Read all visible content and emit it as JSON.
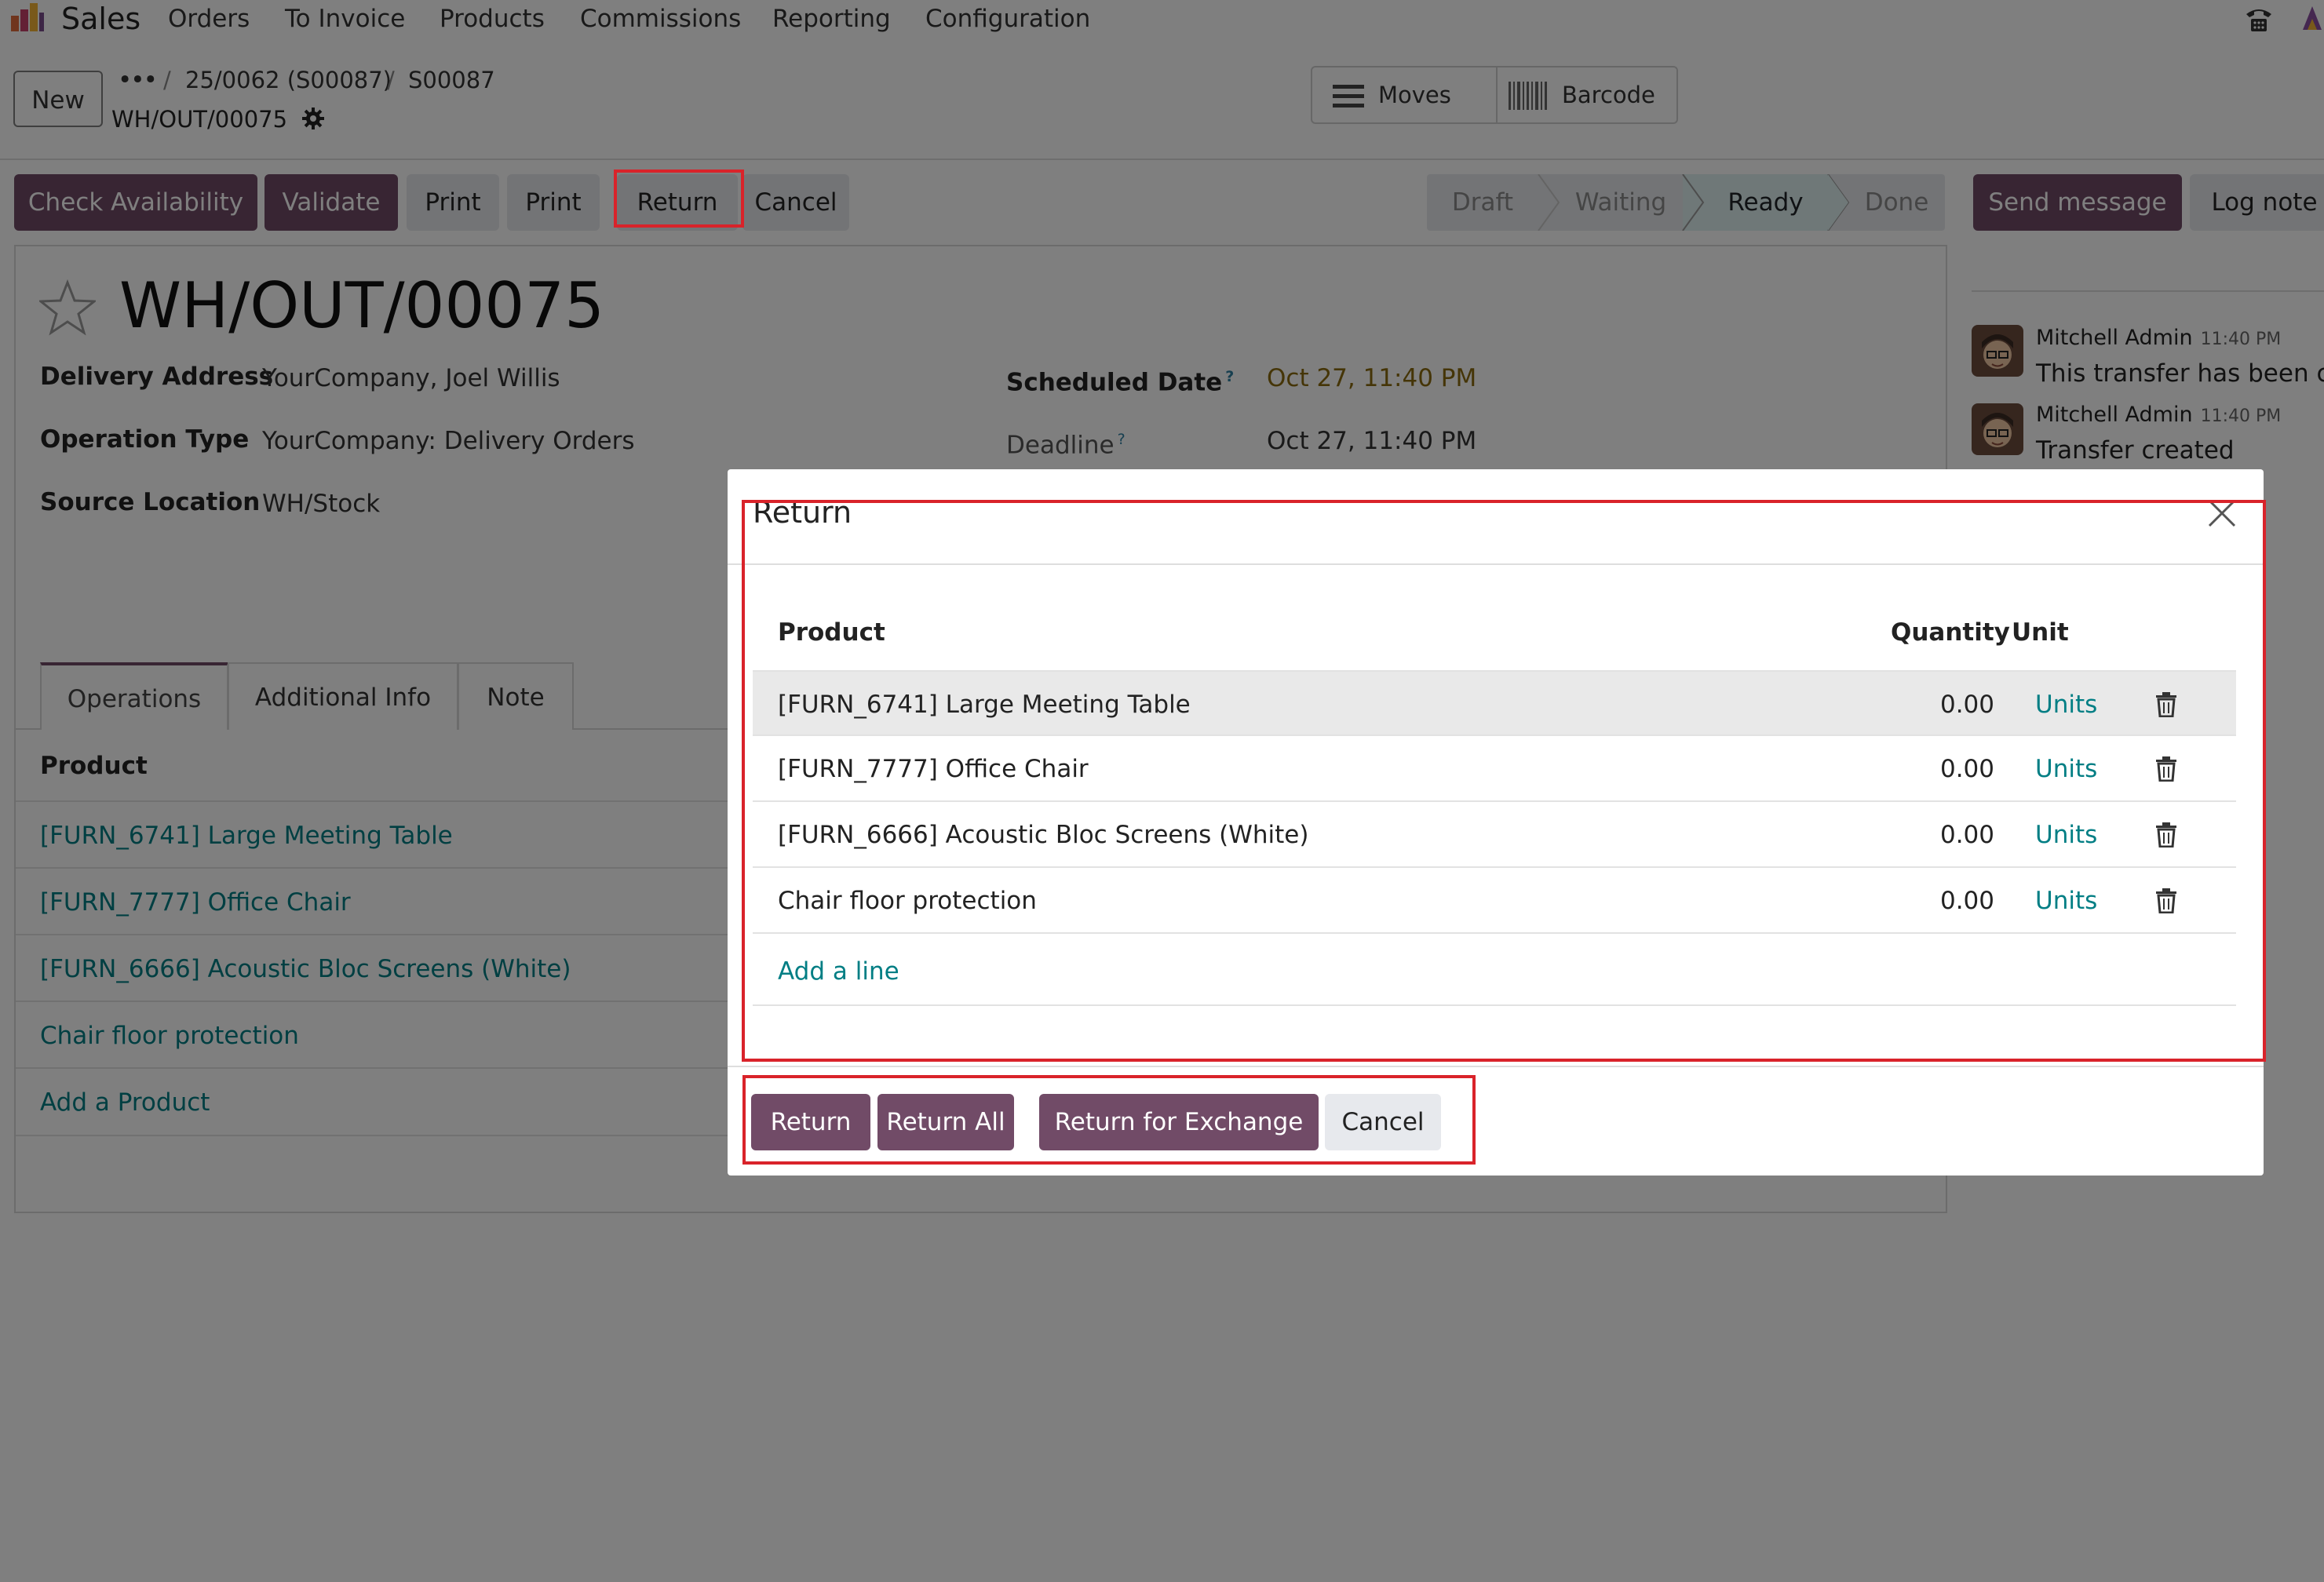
{
  "navbar": {
    "app_name": "Sales",
    "menu": [
      "Orders",
      "To Invoice",
      "Products",
      "Commissions",
      "Reporting",
      "Configuration"
    ]
  },
  "control_panel": {
    "new_label": "New",
    "breadcrumb_dots": "•••",
    "breadcrumbs": [
      "25/0062 (S00087)",
      "S00087"
    ],
    "separator": "/",
    "record_name": "WH/OUT/00075",
    "smart_buttons": {
      "moves": "Moves",
      "barcode": "Barcode"
    }
  },
  "actions": {
    "check_availability": "Check Availability",
    "validate": "Validate",
    "print_1": "Print",
    "print_2": "Print",
    "return": "Return",
    "cancel": "Cancel"
  },
  "status": {
    "stages": [
      "Draft",
      "Waiting",
      "Ready",
      "Done"
    ],
    "current": "Ready"
  },
  "chatter": {
    "send_message": "Send message",
    "log_note": "Log note",
    "messages": [
      {
        "author": "Mitchell Admin",
        "time": "11:40 PM",
        "body": "This transfer has been cr"
      },
      {
        "author": "Mitchell Admin",
        "time": "11:40 PM",
        "body": "Transfer created"
      }
    ]
  },
  "form": {
    "title": "WH/OUT/00075",
    "fields": {
      "delivery_address_label": "Delivery Address",
      "delivery_address": "YourCompany, Joel Willis",
      "operation_type_label": "Operation Type",
      "operation_type": "YourCompany: Delivery Orders",
      "source_location_label": "Source Location",
      "source_location": "WH/Stock",
      "scheduled_date_label": "Scheduled Date",
      "scheduled_date": "Oct 27, 11:40 PM",
      "deadline_label": "Deadline",
      "deadline": "Oct 27, 11:40 PM",
      "help_mark": "?"
    },
    "tabs": [
      "Operations",
      "Additional Info",
      "Note"
    ],
    "product_header": "Product",
    "products": [
      "[FURN_6741] Large Meeting Table",
      "[FURN_7777] Office Chair",
      "[FURN_6666] Acoustic Bloc Screens (White)",
      "Chair floor protection"
    ],
    "add_product": "Add a Product"
  },
  "modal": {
    "title": "Return",
    "headers": {
      "product": "Product",
      "quantity": "Quantity",
      "unit": "Unit"
    },
    "lines": [
      {
        "product": "[FURN_6741] Large Meeting Table",
        "quantity": "0.00",
        "unit": "Units"
      },
      {
        "product": "[FURN_7777] Office Chair",
        "quantity": "0.00",
        "unit": "Units"
      },
      {
        "product": "[FURN_6666] Acoustic Bloc Screens (White)",
        "quantity": "0.00",
        "unit": "Units"
      },
      {
        "product": "Chair floor protection",
        "quantity": "0.00",
        "unit": "Units"
      }
    ],
    "add_line": "Add a line",
    "buttons": {
      "return": "Return",
      "return_all": "Return All",
      "return_exchange": "Return for Exchange",
      "cancel": "Cancel"
    }
  },
  "colors": {
    "primary": "#714b67",
    "link": "#017e84",
    "highlight": "#d9232a",
    "warning_date": "#8b6a0f"
  }
}
